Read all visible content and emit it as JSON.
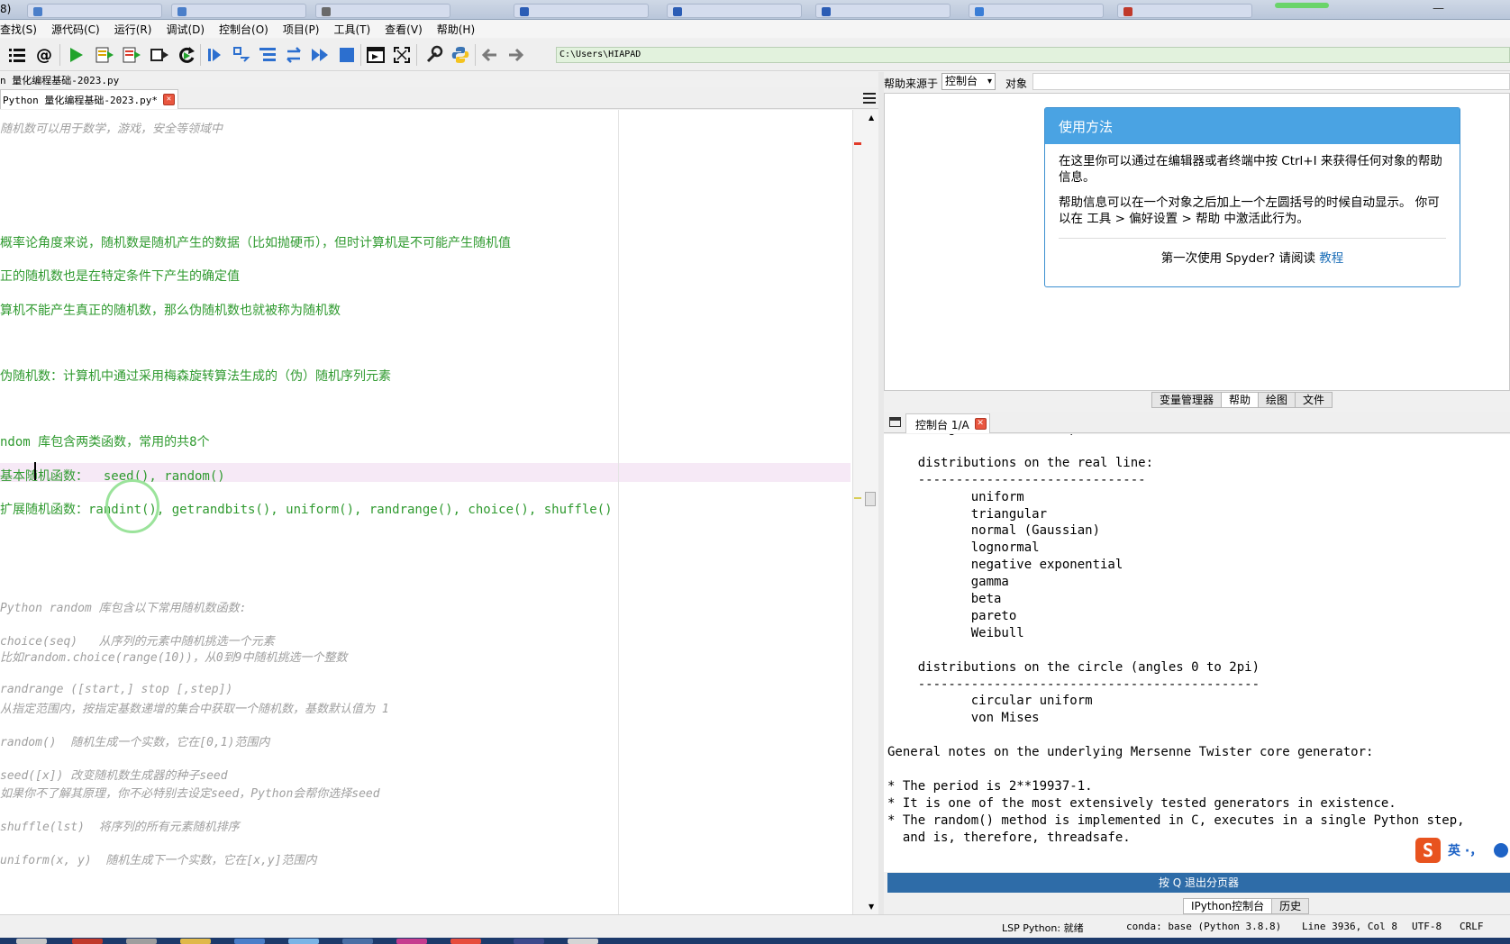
{
  "window": {
    "title_fragment": "8)"
  },
  "menu": [
    "查找(S)",
    "源代码(C)",
    "运行(R)",
    "调试(D)",
    "控制台(O)",
    "项目(P)",
    "工具(T)",
    "查看(V)",
    "帮助(H)"
  ],
  "toolbar": {
    "working_dir": "C:\\Users\\HIAPAD",
    "icons": [
      "list-icon",
      "at-icon",
      "run-icon",
      "run-cell-icon",
      "run-cell-advance-icon",
      "run-selection-icon",
      "rerun-icon",
      "debug-icon",
      "step-icon",
      "step-into-icon",
      "step-return-icon",
      "continue-icon",
      "stop-icon",
      "maximize-pane-icon",
      "fullscreen-icon",
      "preferences-icon",
      "python-path-icon",
      "back-icon",
      "forward-icon"
    ]
  },
  "editor": {
    "file_path": "n 量化编程基础-2023.py",
    "tab_label": "Python 量化编程基础-2023.py*",
    "lines": [
      {
        "text": "随机数可以用于数学，游戏，安全等领域中",
        "style": "c",
        "row": 0
      },
      {
        "text": "概率论角度来说，随机数是随机产生的数据（比如抛硬币），但时计算机是不可能产生随机值",
        "style": "g",
        "row": 1
      },
      {
        "text": "正的随机数也是在特定条件下产生的确定值",
        "style": "g",
        "row": 2
      },
      {
        "text": "算机不能产生真正的随机数，那么伪随机数也就被称为随机数",
        "style": "g",
        "row": 3
      },
      {
        "text": "伪随机数：计算机中通过采用梅森旋转算法生成的（伪）随机序列元素",
        "style": "g",
        "row": 4
      },
      {
        "text": "ndom 库包含两类函数，常用的共8个",
        "style": "g",
        "row": 5
      },
      {
        "text": "基本随机函数：  seed(), random()",
        "style": "g",
        "row": 6
      },
      {
        "text": "扩展随机函数：randint(), getrandbits(), uniform(), randrange(), choice(), shuffle()",
        "style": "g",
        "row": 7
      },
      {
        "text": "Python random 库包含以下常用随机数函数:",
        "style": "c",
        "row": 8
      },
      {
        "text": "choice(seq)   从序列的元素中随机挑选一个元素",
        "style": "c",
        "row": 9
      },
      {
        "text": "比如random.choice(range(10))，从0到9中随机挑选一个整数",
        "style": "c",
        "row": 10
      },
      {
        "text": "randrange ([start,] stop [,step])",
        "style": "c",
        "row": 11
      },
      {
        "text": "从指定范围内，按指定基数递增的集合中获取一个随机数，基数默认值为 1",
        "style": "c",
        "row": 12
      },
      {
        "text": "random()  随机生成一个实数，它在[0,1)范围内",
        "style": "c",
        "row": 13
      },
      {
        "text": "seed([x]) 改变随机数生成器的种子seed",
        "style": "c",
        "row": 14
      },
      {
        "text": "如果你不了解其原理，你不必特别去设定seed，Python会帮你选择seed",
        "style": "c",
        "row": 15
      },
      {
        "text": "shuffle(lst)  将序列的所有元素随机排序",
        "style": "c",
        "row": 16
      },
      {
        "text": "uniform(x, y)  随机生成下一个实数，它在[x,y]范围内",
        "style": "c",
        "row": 17
      }
    ]
  },
  "help": {
    "source_label": "帮助来源于",
    "source_value": "控制台",
    "object_label": "对象",
    "card_title": "使用方法",
    "para1": "在这里你可以通过在编辑器或者终端中按 Ctrl+I 来获得任何对象的帮助信息。",
    "para2": "帮助信息可以在一个对象之后加上一个左圆括号的时候自动显示。 你可以在 工具 > 偏好设置 > 帮助 中激活此行为。",
    "first_time": "第一次使用 Spyder? 请阅读",
    "tutorial_link": "教程",
    "tabs": [
      "变量管理器",
      "帮助",
      "绘图",
      "文件"
    ],
    "active_tab": "帮助"
  },
  "console": {
    "tab_label": "控制台 1/A",
    "lines": [
      "        generate random permutation",
      "",
      "    distributions on the real line:",
      "    ------------------------------",
      "           uniform",
      "           triangular",
      "           normal (Gaussian)",
      "           lognormal",
      "           negative exponential",
      "           gamma",
      "           beta",
      "           pareto",
      "           Weibull",
      "",
      "    distributions on the circle (angles 0 to 2pi)",
      "    ---------------------------------------------",
      "           circular uniform",
      "           von Mises",
      "",
      "General notes on the underlying Mersenne Twister core generator:",
      "",
      "* The period is 2**19937-1.",
      "* It is one of the most extensively tested generators in existence.",
      "* The random() method is implemented in C, executes in a single Python step,",
      "  and is, therefore, threadsafe."
    ],
    "pager": "按 Q 退出分页器",
    "bottom_tabs": [
      "IPython控制台",
      "历史"
    ],
    "ime_label": "英 ·，"
  },
  "status": {
    "lsp": "LSP Python: 就绪",
    "conda": "conda: base (Python 3.8.8)",
    "position": "Line 3936, Col 8",
    "encoding": "UTF-8",
    "eol": "CRLF"
  }
}
